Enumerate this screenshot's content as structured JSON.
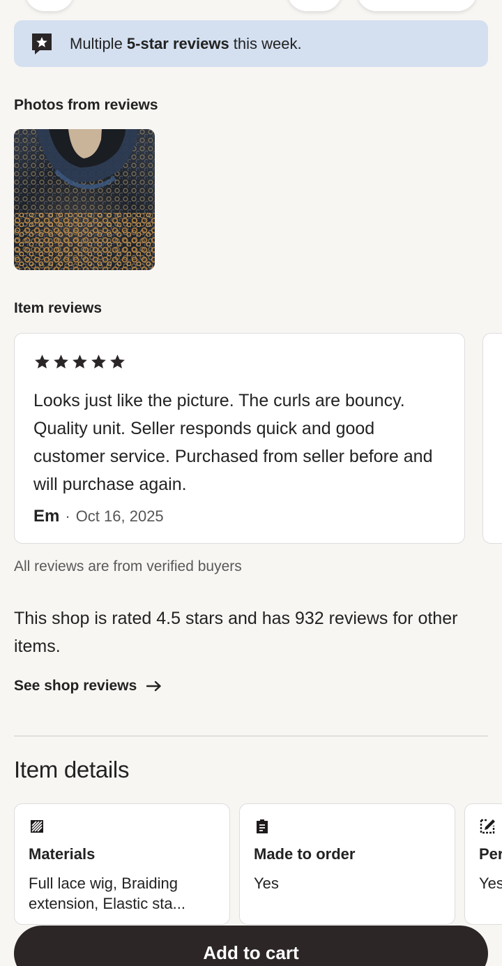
{
  "banner": {
    "prefix": "Multiple ",
    "highlight": "5-star reviews",
    "suffix": " this week."
  },
  "photos_section": {
    "label": "Photos from reviews"
  },
  "reviews_section": {
    "label": "Item reviews"
  },
  "review": {
    "rating": 5,
    "text": "Looks just like the picture.  The curls are bouncy.  Quality unit.  Seller responds quick and good customer service.  Purchased from seller before and will purchase again.",
    "author": "Em",
    "separator": "·",
    "date": "Oct 16, 2025"
  },
  "verified_note": "All reviews are from verified buyers",
  "shop_rating": "This shop is rated 4.5 stars and has 932 reviews for other items.",
  "see_shop_reviews": "See shop reviews",
  "item_details": {
    "title": "Item details",
    "cards": [
      {
        "icon": "materials-icon",
        "title": "Materials",
        "value": "Full lace wig, Braiding extension, Elastic sta..."
      },
      {
        "icon": "clipboard-icon",
        "title": "Made to order",
        "value": "Yes"
      },
      {
        "icon": "personalize-icon",
        "title": "Personalization",
        "value": "Yes"
      }
    ]
  },
  "cart": {
    "label": "Add to cart"
  },
  "colors": {
    "background": "#f8f6f3",
    "banner_bg": "#d4e0f0",
    "button_bg": "#2c2627"
  }
}
